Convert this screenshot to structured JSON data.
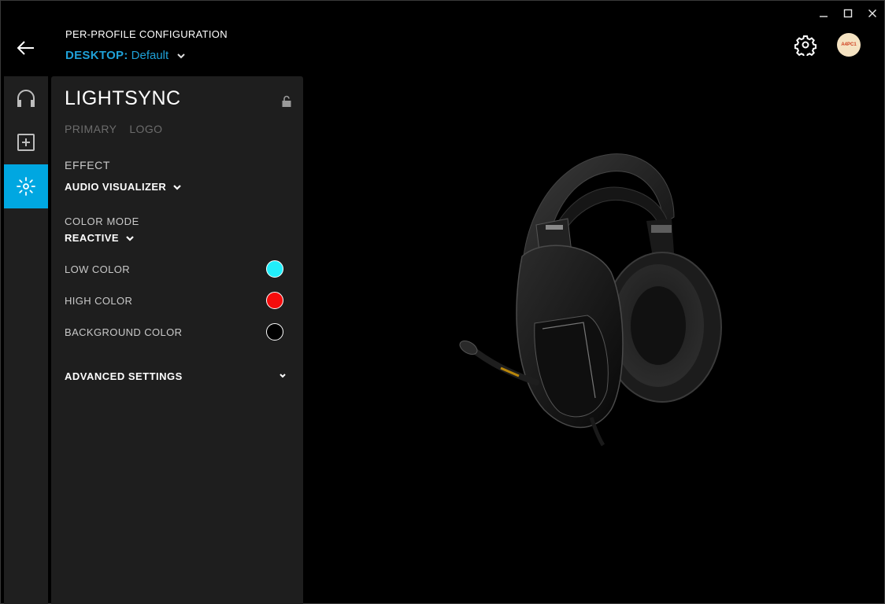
{
  "header": {
    "config_title": "PER-PROFILE CONFIGURATION",
    "profile_kind": "DESKTOP:",
    "profile_name": "Default",
    "avatar_text": "A4PC1"
  },
  "window_controls": [
    "minimize-icon",
    "maximize-icon",
    "close-icon"
  ],
  "rail": {
    "items": [
      {
        "icon": "headset-icon",
        "active": false
      },
      {
        "icon": "plus-square-icon",
        "active": false
      },
      {
        "icon": "lightsync-icon",
        "active": true
      }
    ]
  },
  "panel": {
    "title": "LIGHTSYNC",
    "tabs": [
      "PRIMARY",
      "LOGO"
    ],
    "effect_label": "EFFECT",
    "effect_value": "AUDIO VISUALIZER",
    "color_mode_label": "COLOR MODE",
    "color_mode_value": "REACTIVE",
    "colors": [
      {
        "label": "LOW COLOR",
        "color": "#22eefa"
      },
      {
        "label": "HIGH COLOR",
        "color": "#f40c0c"
      },
      {
        "label": "BACKGROUND COLOR",
        "color": "#000000"
      }
    ],
    "advanced_label": "ADVANCED SETTINGS"
  },
  "accent_color": "#00a7e1"
}
